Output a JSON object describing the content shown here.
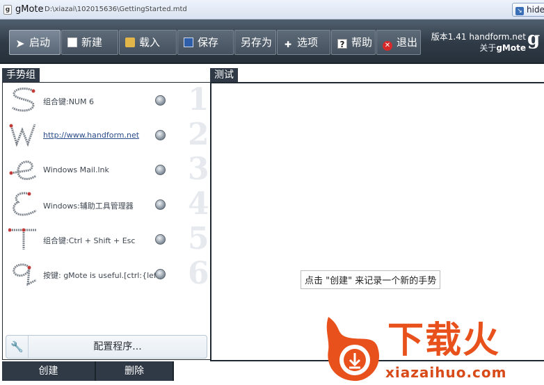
{
  "titlebar": {
    "app_name": "gMote",
    "file_path": "D:\\xiazai\\102015636\\GettingStarted.mtd",
    "hide_label": "hide"
  },
  "toolbar": {
    "buttons": [
      {
        "label": "启动",
        "icon": "cursor-icon"
      },
      {
        "label": "新建",
        "icon": "document-icon"
      },
      {
        "label": "载入",
        "icon": "folder-icon"
      },
      {
        "label": "保存",
        "icon": "book-icon"
      },
      {
        "label": "另存为",
        "icon": ""
      },
      {
        "label": "选项",
        "icon": "plus-icon"
      },
      {
        "label": "帮助",
        "icon": "help-icon"
      },
      {
        "label": "退出",
        "icon": "exit-icon"
      }
    ],
    "version": "版本1.41 handform.net",
    "about_prefix": "关于",
    "about_app": "gMote"
  },
  "left_panel": {
    "tab": "手势组",
    "gestures": [
      {
        "action": "组合键:NUM 6",
        "num": "1",
        "link": false
      },
      {
        "action": "http://www.handform.net",
        "num": "2",
        "link": true
      },
      {
        "action": "Windows Mail.lnk",
        "num": "3",
        "link": false
      },
      {
        "action": "Windows:辅助工具管理器",
        "num": "4",
        "link": false
      },
      {
        "action": "组合键:Ctrl + Shift + Esc",
        "num": "5",
        "link": false
      },
      {
        "action": "按键: gMote is useful.[ctrl:{left}",
        "num": "6",
        "link": false
      }
    ],
    "config_button": "配置程序..."
  },
  "right_panel": {
    "tab": "测试",
    "hint": "点击 \"创建\" 来记录一个新的手势"
  },
  "bottom": {
    "create": "创建",
    "delete": "删除"
  },
  "watermark": {
    "text": "下载火",
    "site": "xiazaihuo.com"
  }
}
